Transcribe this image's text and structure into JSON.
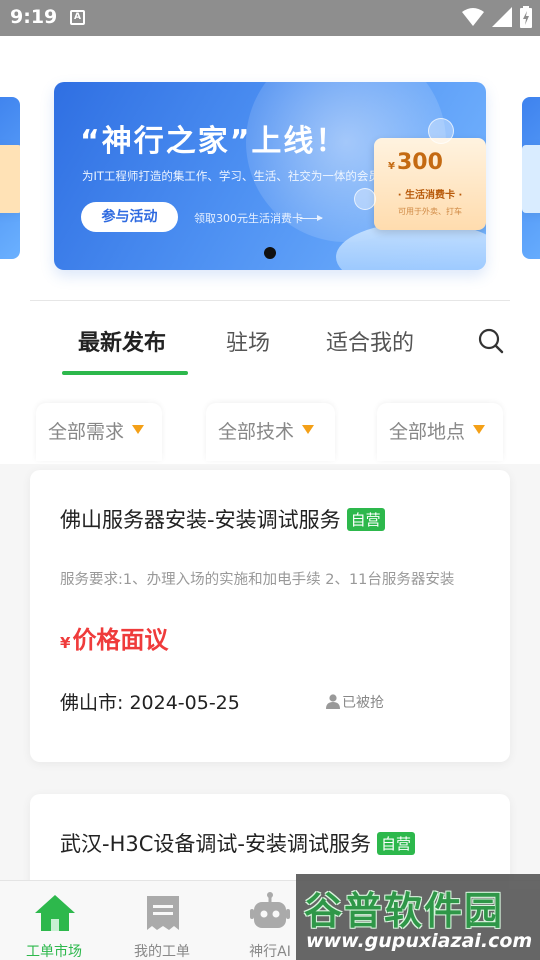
{
  "status_bar": {
    "time": "9:19",
    "notification_icon": "A"
  },
  "banner": {
    "headline": "“神行之家”上线！",
    "subline": "为IT工程师打造的集工作、学习、生活、社交为一体的会员制社群",
    "join_label": "参与活动",
    "voucher_note": "领取300元生活消费卡",
    "voucher_currency": "¥",
    "voucher_amount": "300",
    "voucher_name": "· 生活消费卡 ·",
    "voucher_sub": "可用于外卖、打车"
  },
  "tabs": [
    {
      "label": "最新发布",
      "active": true
    },
    {
      "label": "驻场",
      "active": false
    },
    {
      "label": "适合我的",
      "active": false
    }
  ],
  "filters": [
    {
      "label": "全部需求"
    },
    {
      "label": "全部技术"
    },
    {
      "label": "全部地点"
    }
  ],
  "cards": [
    {
      "title": "佛山服务器安装-安装调试服务",
      "tag": "自营",
      "desc": "服务要求:1、办理入场的实施和加电手续 2、11台服务器安装",
      "price_symbol": "¥",
      "price": "价格面议",
      "meta": "佛山市: 2024-05-25",
      "status": "已被抢"
    },
    {
      "title": "武汉-H3C设备调试-安装调试服务",
      "tag": "自营"
    }
  ],
  "bottom_nav": [
    {
      "label": "工单市场",
      "icon": "home-icon",
      "active": true
    },
    {
      "label": "我的工单",
      "icon": "ticket-icon",
      "active": false
    },
    {
      "label": "神行AI",
      "icon": "robot-icon",
      "active": false
    }
  ],
  "watermark": {
    "line1": "谷普软件园",
    "line2": "www.gupuxiazai.com"
  },
  "colors": {
    "accent_green": "#2db84c",
    "price_red": "#ef3b3b",
    "caret_orange": "#f4a017"
  }
}
